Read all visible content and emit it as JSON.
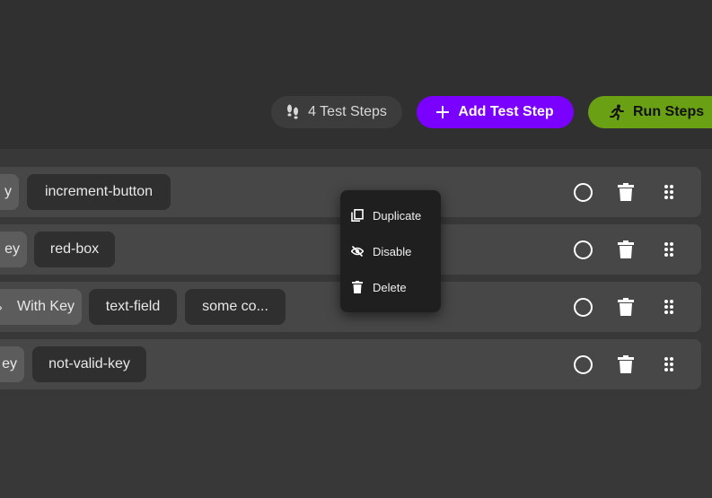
{
  "toolbar": {
    "steps_count_label": "4 Test Steps",
    "add_step_label": "Add Test Step",
    "run_steps_label": "Run Steps"
  },
  "rows": [
    {
      "chips": [
        "y",
        "increment-button"
      ]
    },
    {
      "chips": [
        "ey",
        "red-box"
      ]
    },
    {
      "chips": [
        "With Key",
        "text-field",
        "some co..."
      ]
    },
    {
      "chips": [
        "ey",
        "not-valid-key"
      ]
    }
  ],
  "context_menu": {
    "items": [
      {
        "label": "Duplicate",
        "icon": "copy-icon"
      },
      {
        "label": "Disable",
        "icon": "eye-off-icon"
      },
      {
        "label": "Delete",
        "icon": "trash-icon"
      }
    ]
  },
  "colors": {
    "add_button": "#7a00ff",
    "run_button": "#6aa014",
    "background": "#303030"
  }
}
